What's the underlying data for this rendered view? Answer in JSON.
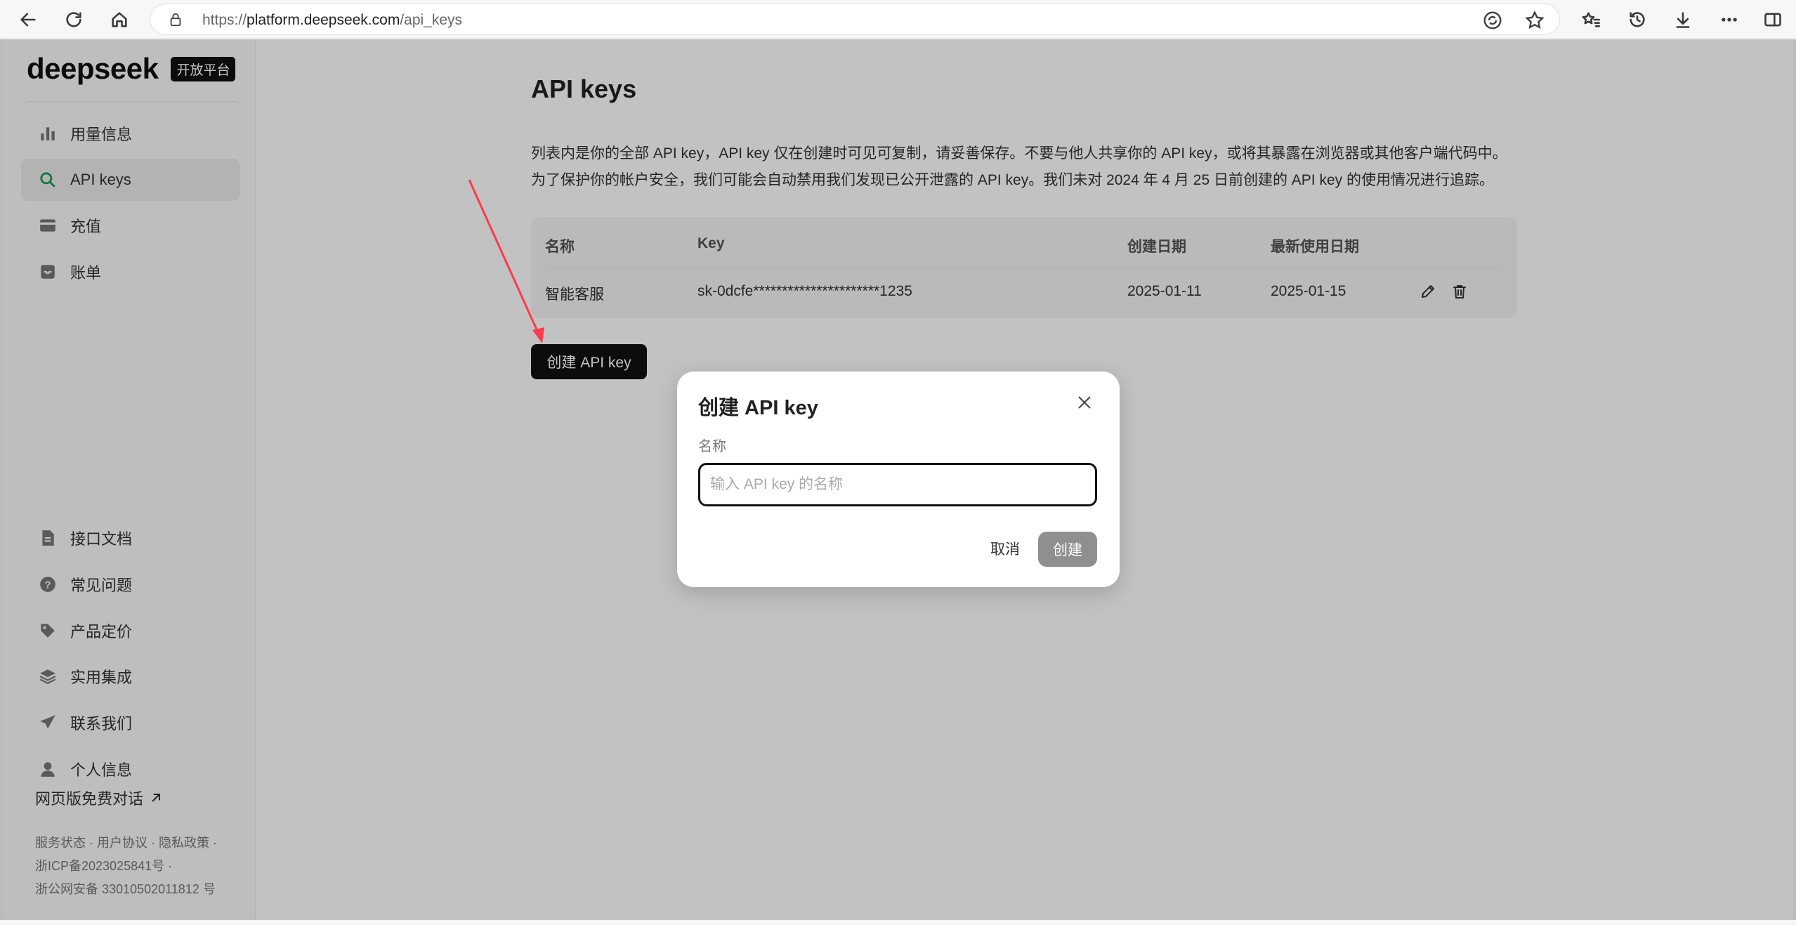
{
  "browser": {
    "url_scheme": "https://",
    "url_host": "platform.deepseek.com",
    "url_path": "/api_keys"
  },
  "brand": {
    "name": "deepseek",
    "badge": "开放平台"
  },
  "sidebar": {
    "items": [
      {
        "label": "用量信息",
        "icon": "bar-chart-icon",
        "active": false
      },
      {
        "label": "API keys",
        "icon": "search-icon",
        "active": true
      },
      {
        "label": "充值",
        "icon": "wallet-icon",
        "active": false
      },
      {
        "label": "账单",
        "icon": "inbox-icon",
        "active": false
      }
    ],
    "bottom_items": [
      {
        "label": "接口文档",
        "icon": "document-icon"
      },
      {
        "label": "常见问题",
        "icon": "question-icon"
      },
      {
        "label": "产品定价",
        "icon": "tag-icon"
      },
      {
        "label": "实用集成",
        "icon": "layers-icon"
      },
      {
        "label": "联系我们",
        "icon": "send-icon"
      },
      {
        "label": "个人信息",
        "icon": "user-icon"
      }
    ],
    "web_chat": "网页版免费对话",
    "footer_line1": "服务状态 · 用户协议 · 隐私政策 ·",
    "footer_line2": "浙ICP备2023025841号 ·",
    "footer_line3": "浙公网安备 33010502011812 号"
  },
  "main": {
    "title": "API keys",
    "desc_line1": "列表内是你的全部 API key，API key 仅在创建时可见可复制，请妥善保存。不要与他人共享你的 API key，或将其暴露在浏览器或其他客户端代码中。",
    "desc_line2": "为了保护你的帐户安全，我们可能会自动禁用我们发现已公开泄露的 API key。我们未对 2024 年 4 月 25 日前创建的 API key 的使用情况进行追踪。",
    "table": {
      "headers": [
        "名称",
        "Key",
        "创建日期",
        "最新使用日期"
      ],
      "rows": [
        {
          "name": "智能客服",
          "key": "sk-0dcfe**********************1235",
          "created": "2025-01-11",
          "last_used": "2025-01-15"
        }
      ]
    },
    "create_button": "创建 API key"
  },
  "modal": {
    "title": "创建 API key",
    "field_label": "名称",
    "input_value": "",
    "input_placeholder": "输入 API key 的名称",
    "cancel": "取消",
    "confirm": "创建"
  },
  "colors": {
    "annotation_arrow": "#ff3b4a",
    "active_icon": "#1a9b57",
    "overlay": "rgba(0,0,0,0.24)"
  }
}
